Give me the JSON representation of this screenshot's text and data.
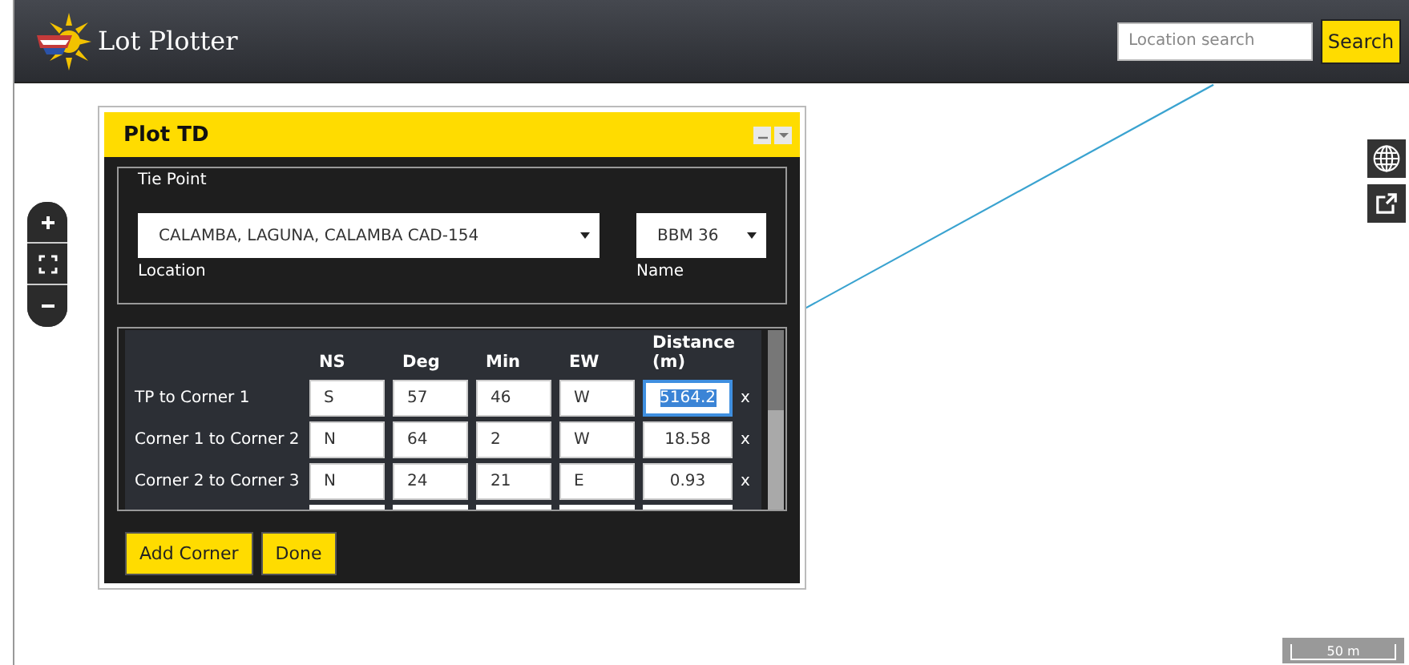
{
  "header": {
    "title": "Lot Plotter",
    "search": {
      "placeholder": "Location search"
    },
    "search_button": "Search"
  },
  "dialog": {
    "title": "Plot TD",
    "tie_point": {
      "legend": "Tie Point",
      "location": {
        "value": "CALAMBA, LAGUNA, CALAMBA CAD-154",
        "label": "Location"
      },
      "name": {
        "value": "BBM 36",
        "label": "Name"
      }
    },
    "table": {
      "columns": [
        "NS",
        "Deg",
        "Min",
        "EW",
        "Distance (m)"
      ],
      "rows": [
        {
          "label": "TP to Corner 1",
          "ns": "S",
          "deg": "57",
          "min": "46",
          "ew": "W",
          "distance": "5164.2",
          "distance_focused": true,
          "remove": "x"
        },
        {
          "label": "Corner 1 to Corner 2",
          "ns": "N",
          "deg": "64",
          "min": "2",
          "ew": "W",
          "distance": "18.58",
          "distance_focused": false,
          "remove": "x"
        },
        {
          "label": "Corner 2 to Corner 3",
          "ns": "N",
          "deg": "24",
          "min": "21",
          "ew": "E",
          "distance": "0.93",
          "distance_focused": false,
          "remove": "x"
        }
      ]
    },
    "buttons": [
      "Add Corner",
      "Done"
    ]
  },
  "scale": "50 m"
}
